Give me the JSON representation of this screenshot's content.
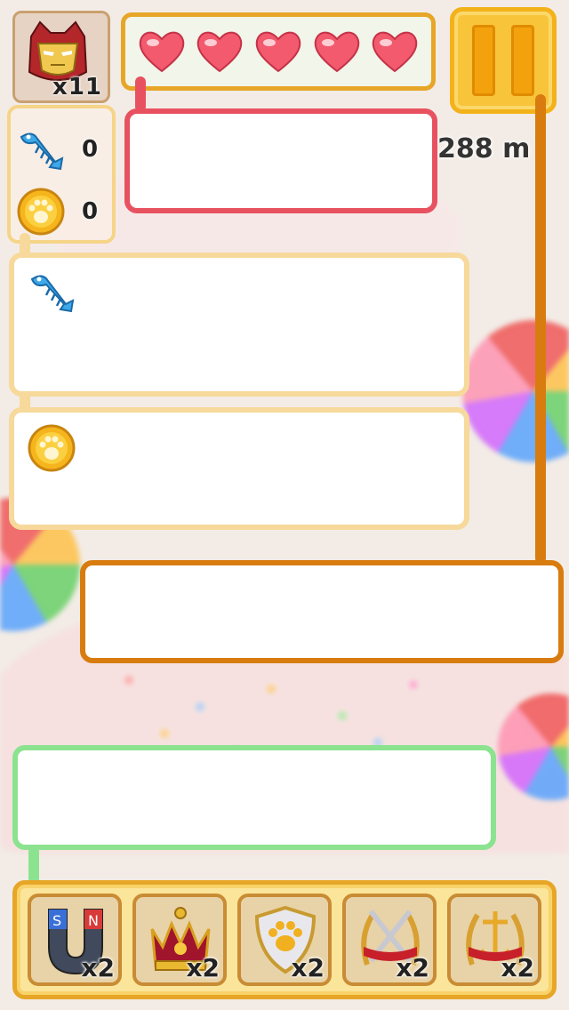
{
  "hud": {
    "lives_count": "x11",
    "hearts": 5,
    "distance": "288 m",
    "fish_count": "0",
    "coin_count": "0"
  },
  "powerups": [
    {
      "name": "magnet",
      "count": "x2"
    },
    {
      "name": "crown",
      "count": "x2"
    },
    {
      "name": "shield",
      "count": "x2"
    },
    {
      "name": "swords",
      "count": "x2"
    },
    {
      "name": "anchor-wreath",
      "count": "x2"
    }
  ],
  "callout_colors": {
    "hearts": "#e85260",
    "pause": "#d97c10",
    "powerups": "#8ce38f",
    "items": "#f6d99b"
  },
  "accent": "#e7a627"
}
